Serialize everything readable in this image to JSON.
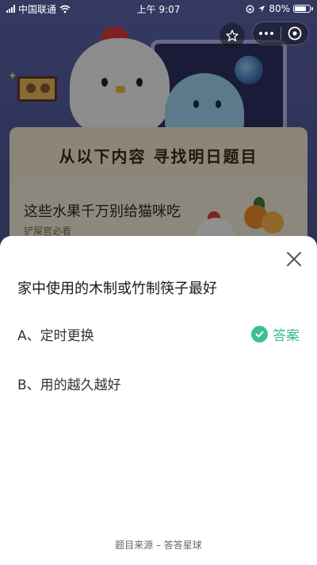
{
  "status_bar": {
    "carrier": "中国联通",
    "time": "上午 9:07",
    "battery": "80%",
    "battery_level": 0.8
  },
  "background": {
    "banner_title": "从以下内容 寻找明日题目",
    "card_title": "这些水果千万别给猫咪吃",
    "card_subtitle": "铲屎官必看"
  },
  "icons": {
    "favorite": "star-icon",
    "more": "more-dots-icon",
    "close_app": "close-circle-icon",
    "close_sheet": "close-icon",
    "check": "check-icon"
  },
  "sheet": {
    "question": "家中使用的木制或竹制筷子最好",
    "options": [
      {
        "label": "A、定时更换",
        "is_answer": true
      },
      {
        "label": "B、用的越久越好",
        "is_answer": false
      }
    ],
    "answer_label": "答案",
    "source": "题目来源 – 答答星球"
  },
  "colors": {
    "accent_green": "#3cc08d",
    "text_dark": "#1a1a1a"
  }
}
